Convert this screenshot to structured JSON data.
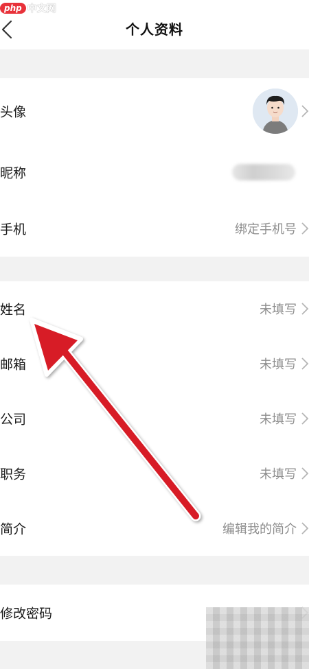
{
  "watermark": {
    "badge": "php",
    "text": "中文网"
  },
  "header": {
    "title": "个人资料",
    "back_icon": "chevron-left-icon"
  },
  "group1": [
    {
      "label": "头像",
      "value": ""
    },
    {
      "label": "昵称",
      "value": ""
    },
    {
      "label": "手机",
      "value": "绑定手机号"
    }
  ],
  "group2": [
    {
      "label": "姓名",
      "value": "未填写"
    },
    {
      "label": "邮箱",
      "value": "未填写"
    },
    {
      "label": "公司",
      "value": "未填写"
    },
    {
      "label": "职务",
      "value": "未填写"
    },
    {
      "label": "简介",
      "value": "编辑我的简介"
    }
  ],
  "group3": [
    {
      "label": "修改密码",
      "value": ""
    }
  ],
  "colors": {
    "arrow": "#d71f26",
    "value_text": "#8e8e8e",
    "background": "#f2f2f2"
  }
}
